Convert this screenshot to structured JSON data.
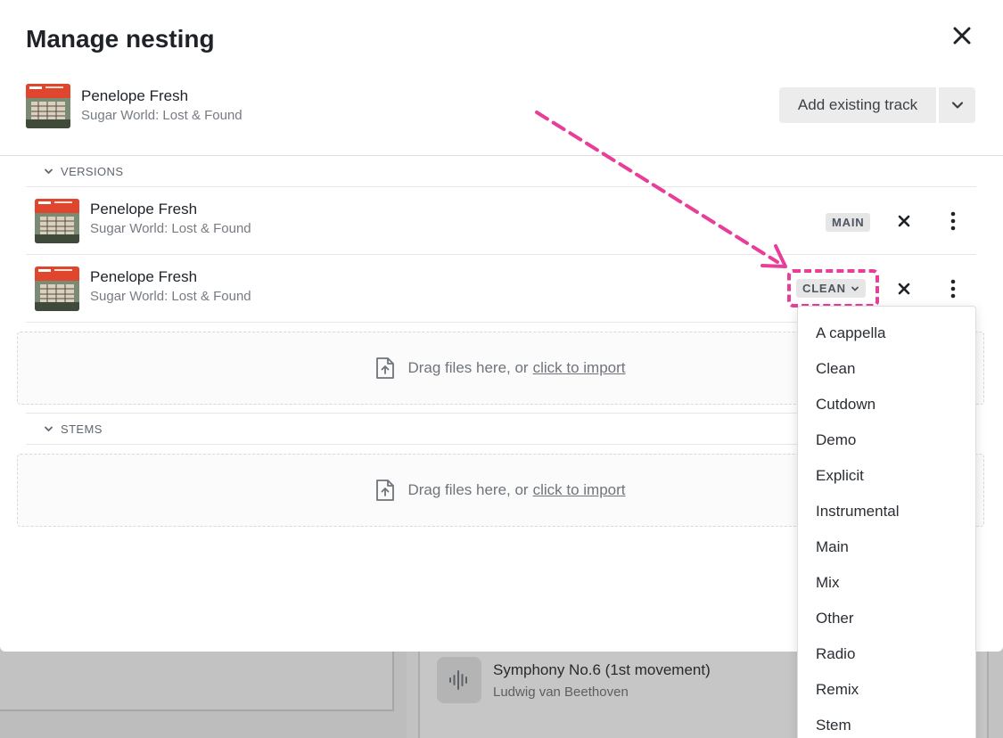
{
  "modal": {
    "title": "Manage nesting",
    "header_track": {
      "title": "Penelope Fresh",
      "subtitle": "Sugar World: Lost & Found"
    },
    "add_button_label": "Add existing track"
  },
  "sections": {
    "versions": {
      "label": "VERSIONS",
      "rows": [
        {
          "title": "Penelope Fresh",
          "subtitle": "Sugar World: Lost & Found",
          "badge": "MAIN"
        },
        {
          "title": "Penelope Fresh",
          "subtitle": "Sugar World: Lost & Found",
          "badge": "CLEAN"
        }
      ],
      "dropzone": {
        "text": "Drag files here, or",
        "link": "click to import"
      }
    },
    "stems": {
      "label": "STEMS",
      "dropzone": {
        "text": "Drag files here, or",
        "link": "click to import"
      }
    }
  },
  "version_menu": {
    "items": [
      "A cappella",
      "Clean",
      "Cutdown",
      "Demo",
      "Explicit",
      "Instrumental",
      "Main",
      "Mix",
      "Other",
      "Radio",
      "Remix",
      "Stem"
    ]
  },
  "background": {
    "track_title": "Symphony No.6 (1st movement)",
    "track_artist": "Ludwig van Beethoven"
  },
  "colors": {
    "annotation": "#e83e9a",
    "badge_bg": "#e6e6e6",
    "overlay": "#bdbdbd"
  },
  "icons": {
    "close": "close-icon",
    "chevron": "chevron-down-icon",
    "remove": "x-icon",
    "more": "more-vertical-icon",
    "upload": "file-upload-icon",
    "waveform": "waveform-icon"
  }
}
